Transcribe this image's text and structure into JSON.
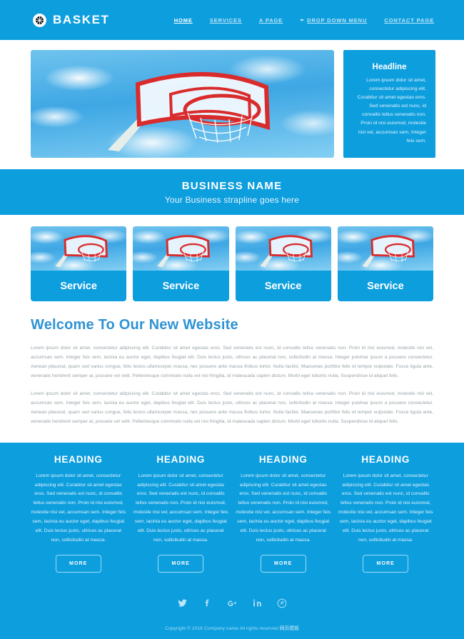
{
  "header": {
    "brand": "BASKET",
    "logo_icon": "basketball-icon",
    "nav": [
      {
        "label": "HOME",
        "active": true,
        "caret": false
      },
      {
        "label": "SERVICES",
        "active": false,
        "caret": false
      },
      {
        "label": "A PAGE",
        "active": false,
        "caret": false
      },
      {
        "label": "DROP DOWN MENU",
        "active": false,
        "caret": true
      },
      {
        "label": "CONTACT PAGE",
        "active": false,
        "caret": false
      }
    ]
  },
  "hero": {
    "image_alt": "basketball-hoop-photo",
    "side": {
      "title": "Headline",
      "text": "Lorem ipsum dolor sit amet, consectetur adipiscing elit. Curabitur sit amet egestas eros. Sed venenatis est nunc, id convallis tellus venenatis non. Proin id nisi euismod, molestie nisl vel, accumsan sem. Integer feis sem."
    }
  },
  "band": {
    "title": "BUSINESS NAME",
    "subtitle": "Your Business strapline goes here"
  },
  "services": [
    {
      "label": "Service"
    },
    {
      "label": "Service"
    },
    {
      "label": "Service"
    },
    {
      "label": "Service"
    }
  ],
  "welcome": {
    "title": "Welcome To Our New Website",
    "paragraph1": "Lorem ipsum dolor sit amet, consectetur adipiscing elit. Curabitur sit amet egestas eros. Sed venenatis est nunc, id convallis tellus venenatis non. Proin id nisi euismod, molestie nisl vel, accumsan sem. Integer feis sem, lacinia eu auctor eget, dapibus feugiat elit. Duis lectus justo, ultrices ac placerat non, sollicitudin at massa. Integer pulvinar ipsum a posuere consectetur. Aenean placerat, quam sed varius congue, felis lectus ullamcorper massa, nec posuere ante massa finibus tortor. Nulla facilisi. Maecenas porttitor felis et tempor vulputate. Fusce ligula ante, venenatis hendrerit semper at, posuere vel velit. Pellentesque commodo nulla vel nisi fringilla, id malesuada sapien dictum. Morbi eget lobortis nulla. Suspendisse id aliquet felis.",
    "paragraph2": "Lorem ipsum dolor sit amet, consectetur adipiscing elit. Curabitur sit amet egestas eros. Sed venenatis est nunc, id convallis tellus venenatis non. Proin id nisi euismod, molestie nisl vel, accumsan sem. Integer feis sem, lacinia eu auctor eget, dapibus feugiat elit. Duis lectus justo, ultrices ac placerat non, sollicitudin at massa. Integer pulvinar ipsum a posuere consectetur. Aenean placerat, quam sed varius congue, felis lectus ullamcorper massa, nec posuere ante massa finibus tortor. Nulla facilisi. Maecenas porttitor felis et tempor vulputate. Fusce ligula ante, venenatis hendrerit semper at, posuere vel velit. Pellentesque commodo nulla vel nisi fringilla, id malesuada sapien dictum. Morbi eget lobortis nulla. Suspendisse id aliquet felis."
  },
  "columns": [
    {
      "title": "HEADING",
      "text": "Lorem ipsum dolor sit amet, consectetur adipiscing elit. Curabitur sit amet egestas eros. Sed venenatis est nunc, id convallis tellus venenatis non. Proin id nisi euismod, molestie nisi vel, accumsan sem. Integer feis sem, lacinia eu auctor eget, dapibus feugiat elit. Duis lectus justo, ultrices ac placerat non, sollicitudin at massa.",
      "button": "MORE"
    },
    {
      "title": "HEADING",
      "text": "Lorem ipsum dolor sit amet, consectetur adipiscing elit. Curabitur sit amet egestas eros. Sed venenatis est nunc, id convallis tellus venenatis non. Proin id nisi euismod, molestie nisi vel, accumsan sem. Integer feis sem, lacinia eu auctor eget, dapibus feugiat elit. Duis lectus justo, ultrices ac placerat non, sollicitudin at massa.",
      "button": "MORE"
    },
    {
      "title": "HEADING",
      "text": "Lorem ipsum dolor sit amet, consectetur adipiscing elit. Curabitur sit amet egestas eros. Sed venenatis est nunc, id convallis tellus venenatis non. Proin id nisi euismod, molestie nisi vel, accumsan sem. Integer feis sem, lacinia eu auctor eget, dapibus feugiat elit. Duis lectus justo, ultrices ac placerat non, sollicitudin at massa.",
      "button": "MORE"
    },
    {
      "title": "HEADING",
      "text": "Lorem ipsum dolor sit amet, consectetur adipiscing elit. Curabitur sit amet egestas eros. Sed venenatis est nunc, id convallis tellus venenatis non. Proin id nisi euismod, molestie nisi vel, accumsan sem. Integer feis sem, lacinia eu auctor eget, dapibus feugiat elit. Duis lectus justo, ultrices ac placerat non, sollicitudin at massa.",
      "button": "MORE"
    }
  ],
  "footer": {
    "social": [
      {
        "name": "twitter-icon"
      },
      {
        "name": "facebook-icon"
      },
      {
        "name": "google-plus-icon"
      },
      {
        "name": "linkedin-icon"
      },
      {
        "name": "pinterest-icon"
      }
    ],
    "copyright": "Copyright © 2016 Company name All rights reserved",
    "credit": "网页模板"
  },
  "colors": {
    "brand_blue": "#0d9ede",
    "heading_blue": "#2f93d4",
    "body_gray": "#9aa3a9",
    "white": "#ffffff"
  }
}
